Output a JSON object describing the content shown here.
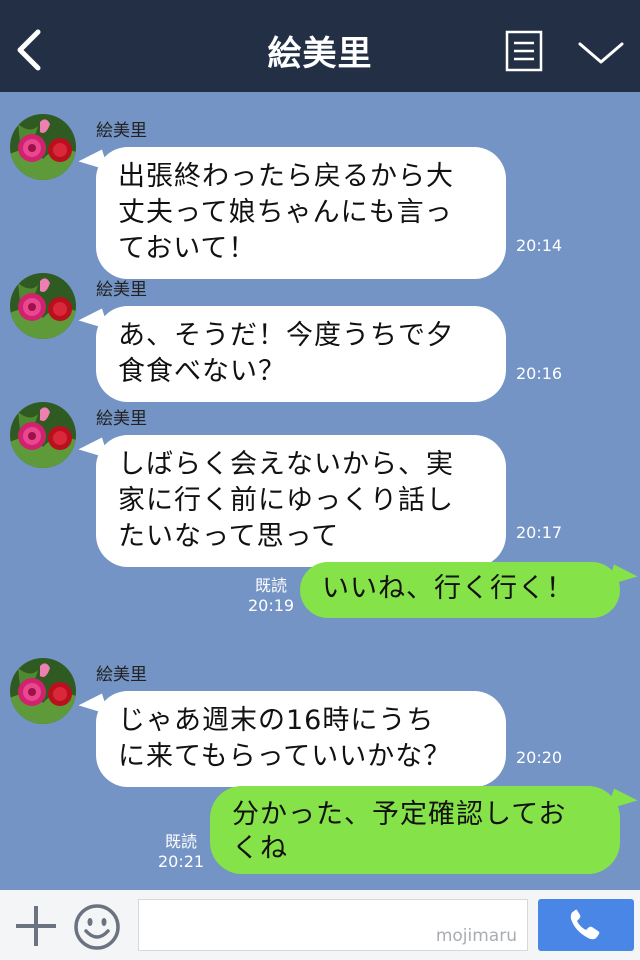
{
  "header": {
    "title": "絵美里",
    "back_icon": "chevron-left-icon",
    "menu_icon": "menu-icon",
    "expand_icon": "chevron-down-icon"
  },
  "messages": [
    {
      "sender": "絵美里",
      "lines": [
        "出張終わったら戻るから大",
        "丈夫って娘ちゃんにも言っ",
        "ておいて！"
      ],
      "time": "20:14"
    },
    {
      "sender": "絵美里",
      "lines": [
        "あ、そうだ！今度うちで夕",
        "食食べない？"
      ],
      "time": "20:16"
    },
    {
      "sender": "絵美里",
      "lines": [
        "しばらく会えないから、実",
        "家に行く前にゆっくり話し",
        "たいなって思って"
      ],
      "time": "20:17"
    },
    {
      "lines": [
        "いいね、行く行く！"
      ],
      "read": "既読",
      "time": "20:19"
    },
    {
      "sender": "絵美里",
      "lines": [
        "じゃあ週末の16時にうち",
        "に来てもらっていいかな？"
      ],
      "time": "20:20"
    },
    {
      "lines": [
        "分かった、予定確認してお",
        "くね"
      ],
      "read": "既読",
      "time": "20:21"
    }
  ],
  "footer": {
    "watermark": "mojimaru",
    "plus_icon": "plus-icon",
    "emoji_icon": "smiley-icon",
    "call_icon": "phone-icon"
  },
  "colors": {
    "background": "#7494c5",
    "header": "#232f45",
    "outgoing": "#85e249",
    "incoming": "#ffffff",
    "call_button": "#4a86e6"
  }
}
